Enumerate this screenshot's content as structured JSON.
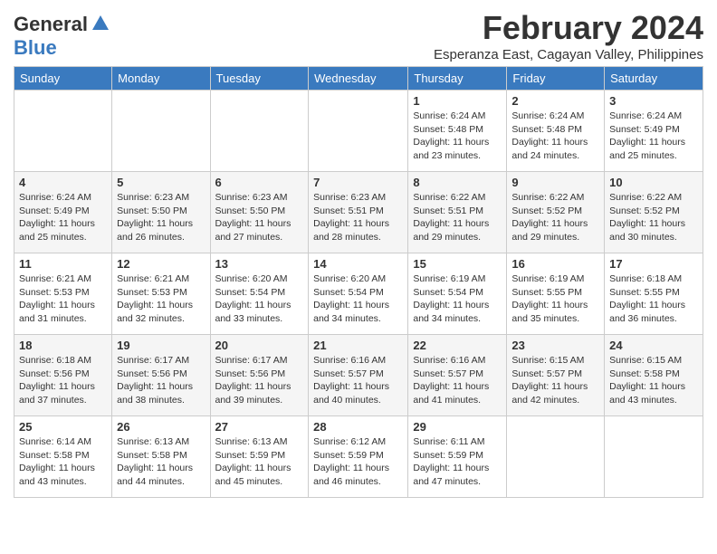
{
  "logo": {
    "general": "General",
    "blue": "Blue"
  },
  "header": {
    "month_year": "February 2024",
    "subtitle": "Esperanza East, Cagayan Valley, Philippines"
  },
  "days": [
    "Sunday",
    "Monday",
    "Tuesday",
    "Wednesday",
    "Thursday",
    "Friday",
    "Saturday"
  ],
  "weeks": [
    [
      {
        "date": "",
        "info": ""
      },
      {
        "date": "",
        "info": ""
      },
      {
        "date": "",
        "info": ""
      },
      {
        "date": "",
        "info": ""
      },
      {
        "date": "1",
        "info": "Sunrise: 6:24 AM\nSunset: 5:48 PM\nDaylight: 11 hours and 23 minutes."
      },
      {
        "date": "2",
        "info": "Sunrise: 6:24 AM\nSunset: 5:48 PM\nDaylight: 11 hours and 24 minutes."
      },
      {
        "date": "3",
        "info": "Sunrise: 6:24 AM\nSunset: 5:49 PM\nDaylight: 11 hours and 25 minutes."
      }
    ],
    [
      {
        "date": "4",
        "info": "Sunrise: 6:24 AM\nSunset: 5:49 PM\nDaylight: 11 hours and 25 minutes."
      },
      {
        "date": "5",
        "info": "Sunrise: 6:23 AM\nSunset: 5:50 PM\nDaylight: 11 hours and 26 minutes."
      },
      {
        "date": "6",
        "info": "Sunrise: 6:23 AM\nSunset: 5:50 PM\nDaylight: 11 hours and 27 minutes."
      },
      {
        "date": "7",
        "info": "Sunrise: 6:23 AM\nSunset: 5:51 PM\nDaylight: 11 hours and 28 minutes."
      },
      {
        "date": "8",
        "info": "Sunrise: 6:22 AM\nSunset: 5:51 PM\nDaylight: 11 hours and 29 minutes."
      },
      {
        "date": "9",
        "info": "Sunrise: 6:22 AM\nSunset: 5:52 PM\nDaylight: 11 hours and 29 minutes."
      },
      {
        "date": "10",
        "info": "Sunrise: 6:22 AM\nSunset: 5:52 PM\nDaylight: 11 hours and 30 minutes."
      }
    ],
    [
      {
        "date": "11",
        "info": "Sunrise: 6:21 AM\nSunset: 5:53 PM\nDaylight: 11 hours and 31 minutes."
      },
      {
        "date": "12",
        "info": "Sunrise: 6:21 AM\nSunset: 5:53 PM\nDaylight: 11 hours and 32 minutes."
      },
      {
        "date": "13",
        "info": "Sunrise: 6:20 AM\nSunset: 5:54 PM\nDaylight: 11 hours and 33 minutes."
      },
      {
        "date": "14",
        "info": "Sunrise: 6:20 AM\nSunset: 5:54 PM\nDaylight: 11 hours and 34 minutes."
      },
      {
        "date": "15",
        "info": "Sunrise: 6:19 AM\nSunset: 5:54 PM\nDaylight: 11 hours and 34 minutes."
      },
      {
        "date": "16",
        "info": "Sunrise: 6:19 AM\nSunset: 5:55 PM\nDaylight: 11 hours and 35 minutes."
      },
      {
        "date": "17",
        "info": "Sunrise: 6:18 AM\nSunset: 5:55 PM\nDaylight: 11 hours and 36 minutes."
      }
    ],
    [
      {
        "date": "18",
        "info": "Sunrise: 6:18 AM\nSunset: 5:56 PM\nDaylight: 11 hours and 37 minutes."
      },
      {
        "date": "19",
        "info": "Sunrise: 6:17 AM\nSunset: 5:56 PM\nDaylight: 11 hours and 38 minutes."
      },
      {
        "date": "20",
        "info": "Sunrise: 6:17 AM\nSunset: 5:56 PM\nDaylight: 11 hours and 39 minutes."
      },
      {
        "date": "21",
        "info": "Sunrise: 6:16 AM\nSunset: 5:57 PM\nDaylight: 11 hours and 40 minutes."
      },
      {
        "date": "22",
        "info": "Sunrise: 6:16 AM\nSunset: 5:57 PM\nDaylight: 11 hours and 41 minutes."
      },
      {
        "date": "23",
        "info": "Sunrise: 6:15 AM\nSunset: 5:57 PM\nDaylight: 11 hours and 42 minutes."
      },
      {
        "date": "24",
        "info": "Sunrise: 6:15 AM\nSunset: 5:58 PM\nDaylight: 11 hours and 43 minutes."
      }
    ],
    [
      {
        "date": "25",
        "info": "Sunrise: 6:14 AM\nSunset: 5:58 PM\nDaylight: 11 hours and 43 minutes."
      },
      {
        "date": "26",
        "info": "Sunrise: 6:13 AM\nSunset: 5:58 PM\nDaylight: 11 hours and 44 minutes."
      },
      {
        "date": "27",
        "info": "Sunrise: 6:13 AM\nSunset: 5:59 PM\nDaylight: 11 hours and 45 minutes."
      },
      {
        "date": "28",
        "info": "Sunrise: 6:12 AM\nSunset: 5:59 PM\nDaylight: 11 hours and 46 minutes."
      },
      {
        "date": "29",
        "info": "Sunrise: 6:11 AM\nSunset: 5:59 PM\nDaylight: 11 hours and 47 minutes."
      },
      {
        "date": "",
        "info": ""
      },
      {
        "date": "",
        "info": ""
      }
    ]
  ]
}
